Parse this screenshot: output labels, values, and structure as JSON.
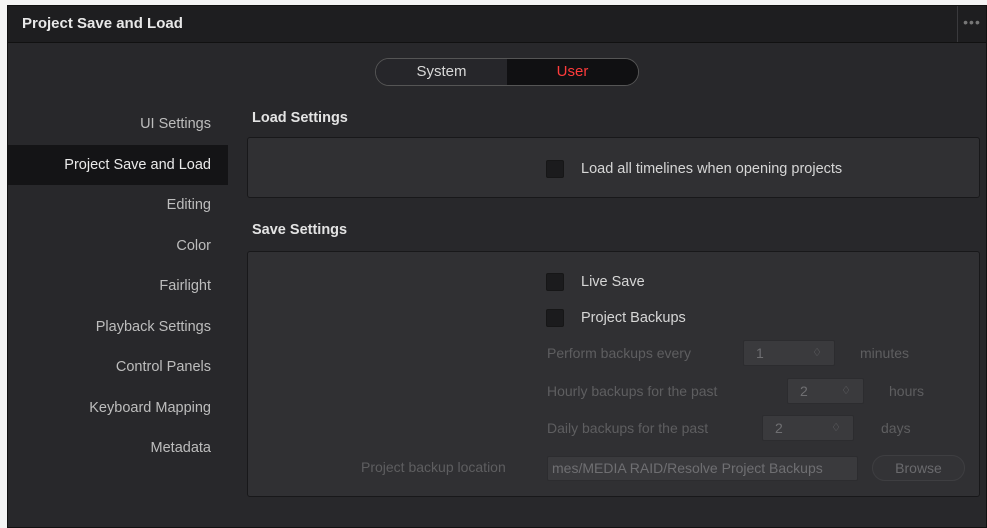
{
  "window": {
    "title": "Project Save and Load",
    "menu_icon": "•••"
  },
  "scope": {
    "options": [
      "System",
      "User"
    ],
    "selected": "User"
  },
  "sidebar": {
    "items": [
      {
        "label": "UI Settings"
      },
      {
        "label": "Project Save and Load",
        "active": true
      },
      {
        "label": "Editing"
      },
      {
        "label": "Color"
      },
      {
        "label": "Fairlight"
      },
      {
        "label": "Playback Settings"
      },
      {
        "label": "Control Panels"
      },
      {
        "label": "Keyboard Mapping"
      },
      {
        "label": "Metadata"
      }
    ]
  },
  "load_settings": {
    "title": "Load Settings",
    "load_all_timelines": {
      "label": "Load all timelines when opening projects",
      "checked": false
    }
  },
  "save_settings": {
    "title": "Save Settings",
    "live_save": {
      "label": "Live Save",
      "checked": false
    },
    "project_backups": {
      "label": "Project Backups",
      "checked": false
    },
    "perform_backups": {
      "label": "Perform backups every",
      "value": "1",
      "unit": "minutes"
    },
    "hourly_backups": {
      "label": "Hourly backups for the past",
      "value": "2",
      "unit": "hours"
    },
    "daily_backups": {
      "label": "Daily backups for the past",
      "value": "2",
      "unit": "days"
    },
    "backup_location": {
      "label": "Project backup location",
      "value": "mes/MEDIA RAID/Resolve Project Backups",
      "browse_label": "Browse"
    },
    "spinner_arrows": "♢"
  }
}
